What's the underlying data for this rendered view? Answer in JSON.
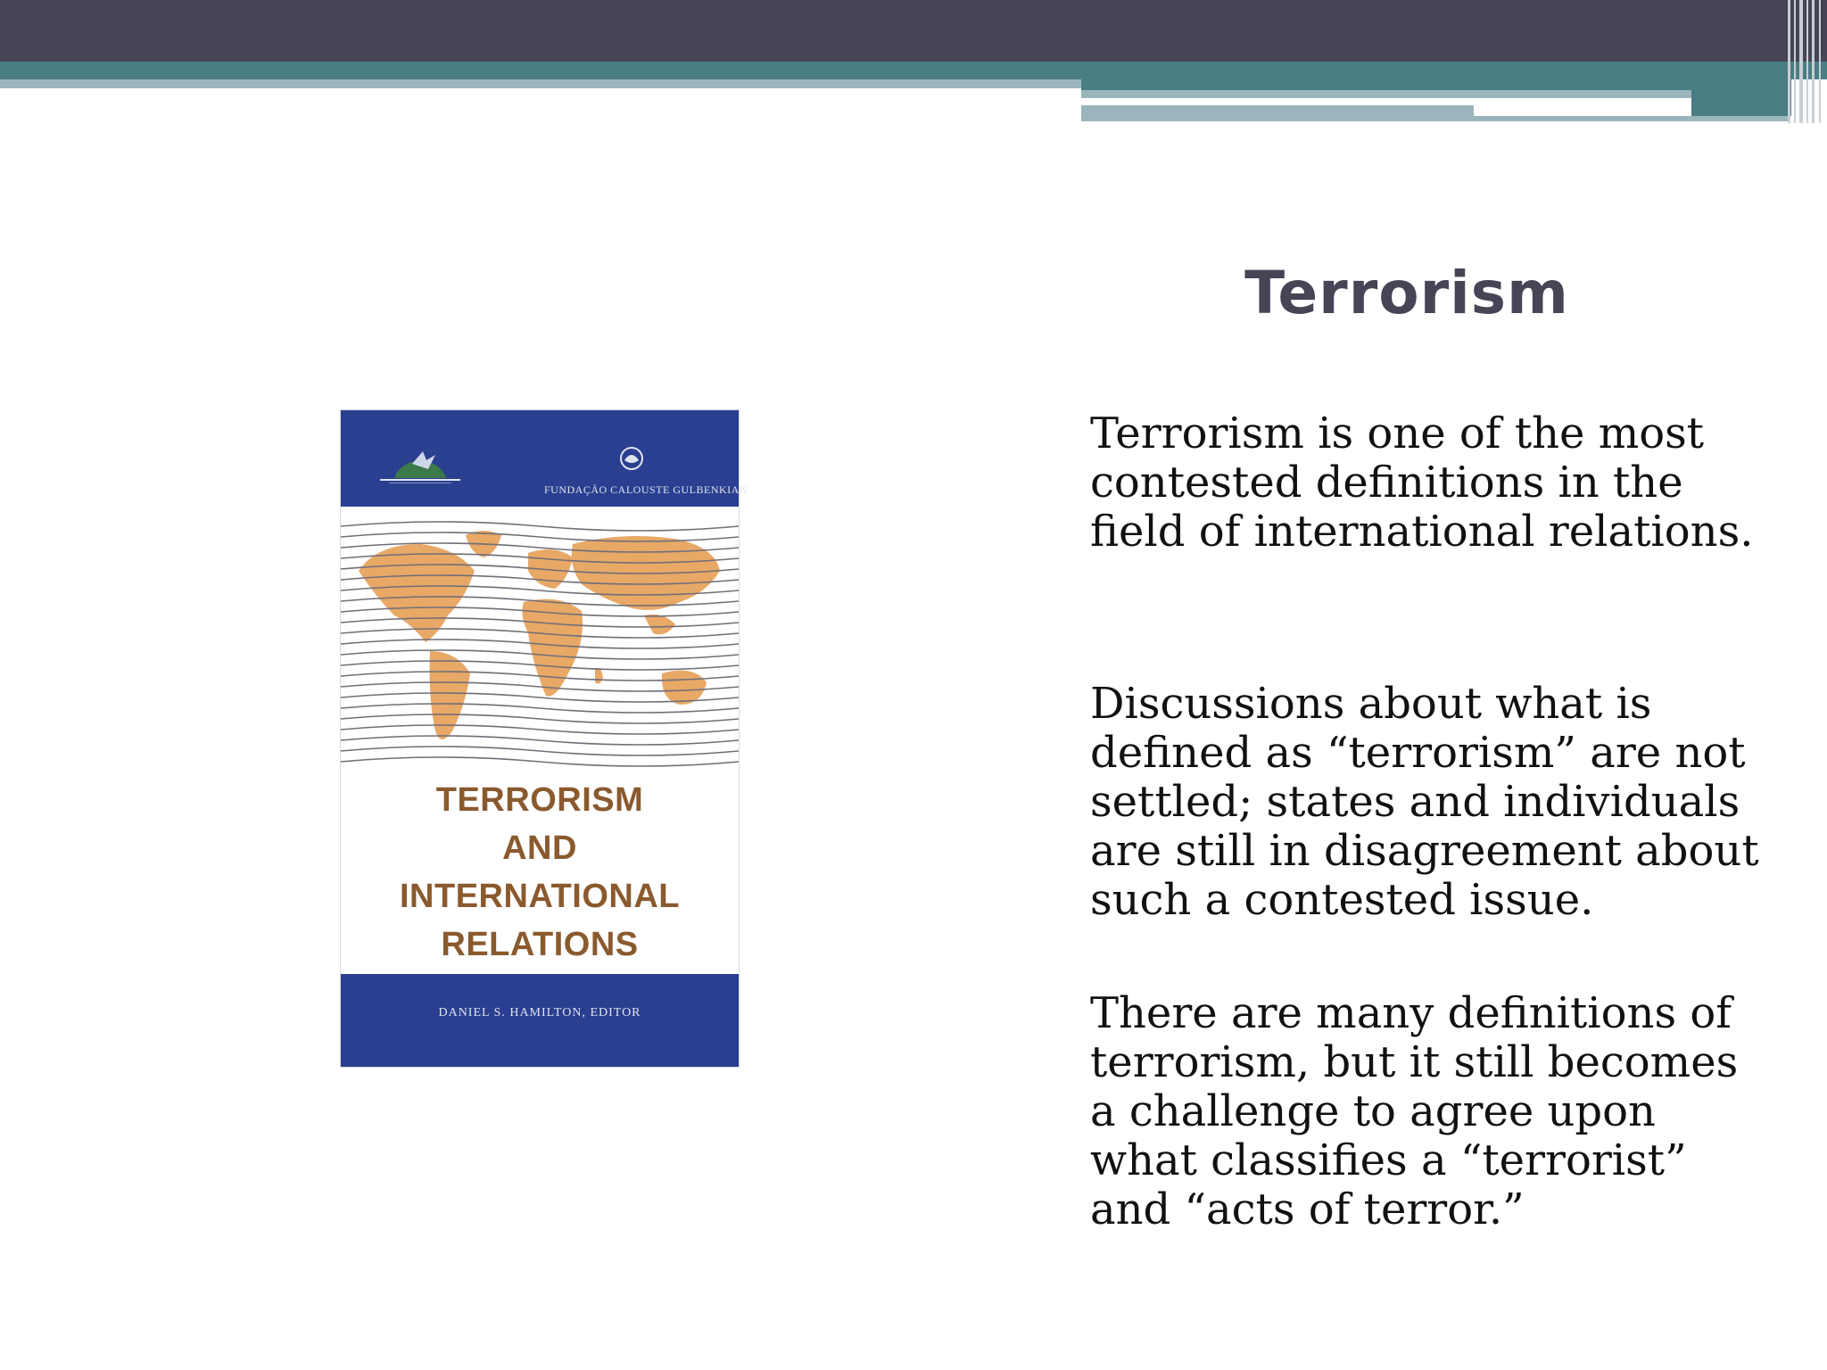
{
  "slide": {
    "title": "Terrorism",
    "paragraphs": [
      "Terrorism is one of the most contested definitions in the field of international relations.",
      "Discussions about what is defined as “terrorism” are not settled; states and individuals are still in disagreement about such a contested issue.",
      "There are many definitions of terrorism, but it still becomes a challenge to agree upon what classifies a “terrorist” and “acts of terror.”"
    ]
  },
  "book_cover": {
    "publisher": "FUNDAÇÃO CALOUSTE GULBENKIAN",
    "title_lines": [
      "TERRORISM",
      "AND",
      "INTERNATIONAL",
      "RELATIONS"
    ],
    "editor": "DANIEL S. HAMILTON, EDITOR"
  },
  "colors": {
    "header_dark": "#454556",
    "header_teal": "#4b7d85",
    "header_light": "#9ab6bc",
    "title": "#454556",
    "book_blue": "#2a3f8f",
    "book_map": "#e8a866"
  }
}
